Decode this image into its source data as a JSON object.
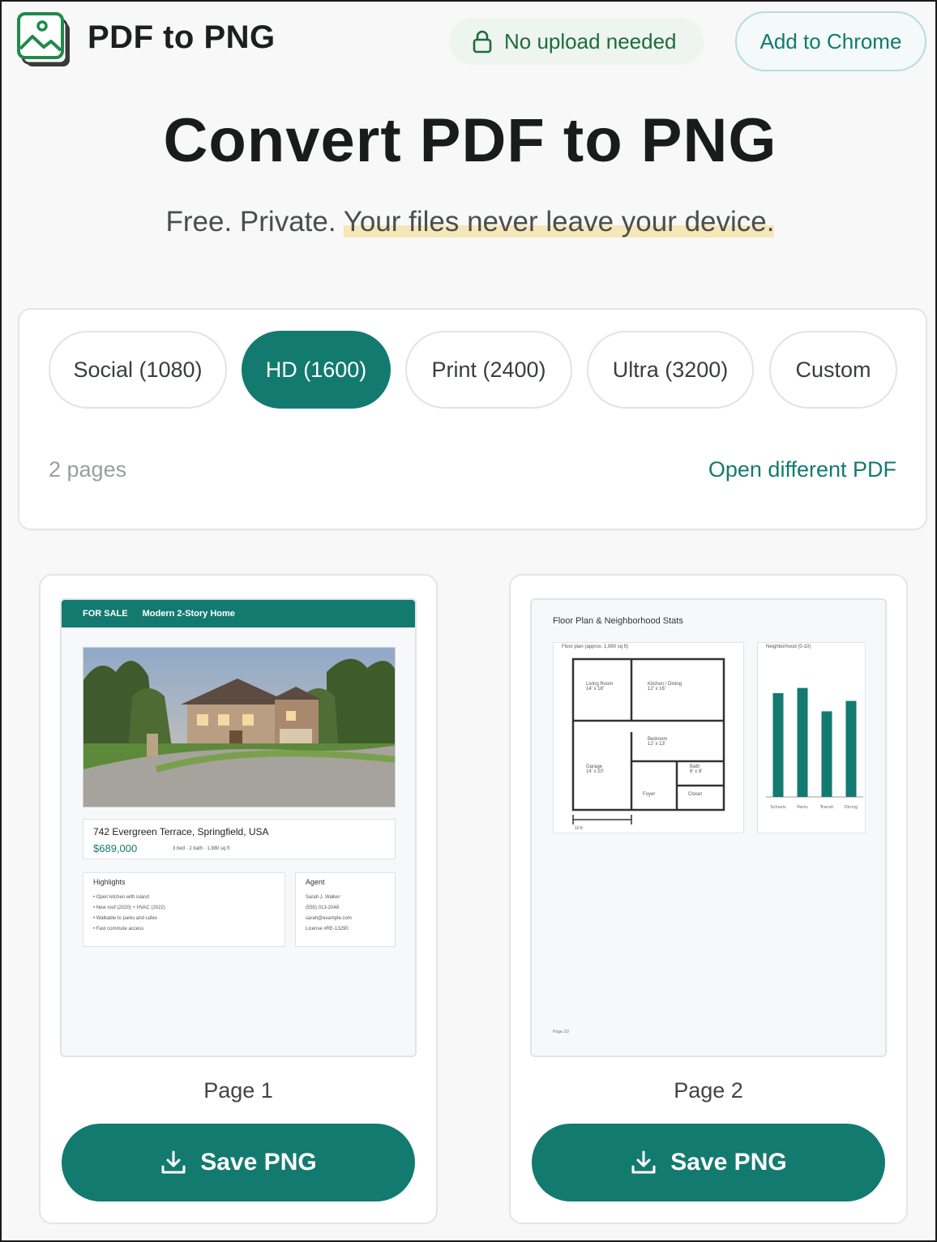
{
  "header": {
    "brand": "PDF to PNG",
    "logo_icon": "image-stack-icon",
    "badge": {
      "icon": "lock-icon",
      "label": "No upload needed"
    },
    "chrome_button": "Add to Chrome"
  },
  "hero": {
    "title": "Convert PDF to PNG",
    "subtitle_plain": "Free. Private.",
    "subtitle_highlight": "Your files never leave your device."
  },
  "settings": {
    "presets": [
      {
        "label": "Social (1080)",
        "active": false
      },
      {
        "label": "HD (1600)",
        "active": true
      },
      {
        "label": "Print (2400)",
        "active": false
      },
      {
        "label": "Ultra (3200)",
        "active": false
      },
      {
        "label": "Custom",
        "active": false
      }
    ],
    "page_count": "2 pages",
    "open_different": "Open different PDF"
  },
  "pages": [
    {
      "label": "Page 1",
      "save_label": "Save PNG",
      "preview": {
        "banner_tag": "FOR SALE",
        "banner_title": "Modern 2-Story Home",
        "address": "742 Evergreen Terrace, Springfield, USA",
        "price": "$689,000",
        "meta": "3 bed · 2 bath · 1,980 sq ft",
        "highlights_title": "Highlights",
        "highlights": [
          "• Open kitchen with island",
          "• New roof (2020) + HVAC (2022)",
          "• Walkable to parks and cafes",
          "• Fast commute access"
        ],
        "agent_title": "Agent",
        "agent_lines": [
          "Sarah J. Walker",
          "(555) 013-2048",
          "sarah@example.com",
          "License #RE-13290"
        ]
      }
    },
    {
      "label": "Page 2",
      "save_label": "Save PNG",
      "preview": {
        "title": "Floor Plan & Neighborhood Stats",
        "floor_caption": "Floor plan (approx. 1,980 sq ft)",
        "rooms": [
          "Living Room",
          "Kitchen / Dining",
          "Bedroom",
          "Garage",
          "Bath",
          "Foyer",
          "Closet"
        ],
        "room_dims": [
          "14' x 18'",
          "12' x 16'",
          "12' x 13'",
          "14' x 20'",
          "6' x 8'"
        ],
        "scale_label": "10 ft",
        "chart_caption": "Neighborhood (0-10)",
        "chart_categories": [
          "Schools",
          "Parks",
          "Transit",
          "Dining"
        ],
        "chart_values": [
          8.0,
          8.4,
          6.6,
          7.4
        ],
        "chart_ylim": [
          0,
          10
        ],
        "footer": "Page 2/2"
      }
    }
  ],
  "colors": {
    "accent": "#137a70",
    "badge_text": "#1d6b3c",
    "highlight": "#f6e7b8"
  }
}
